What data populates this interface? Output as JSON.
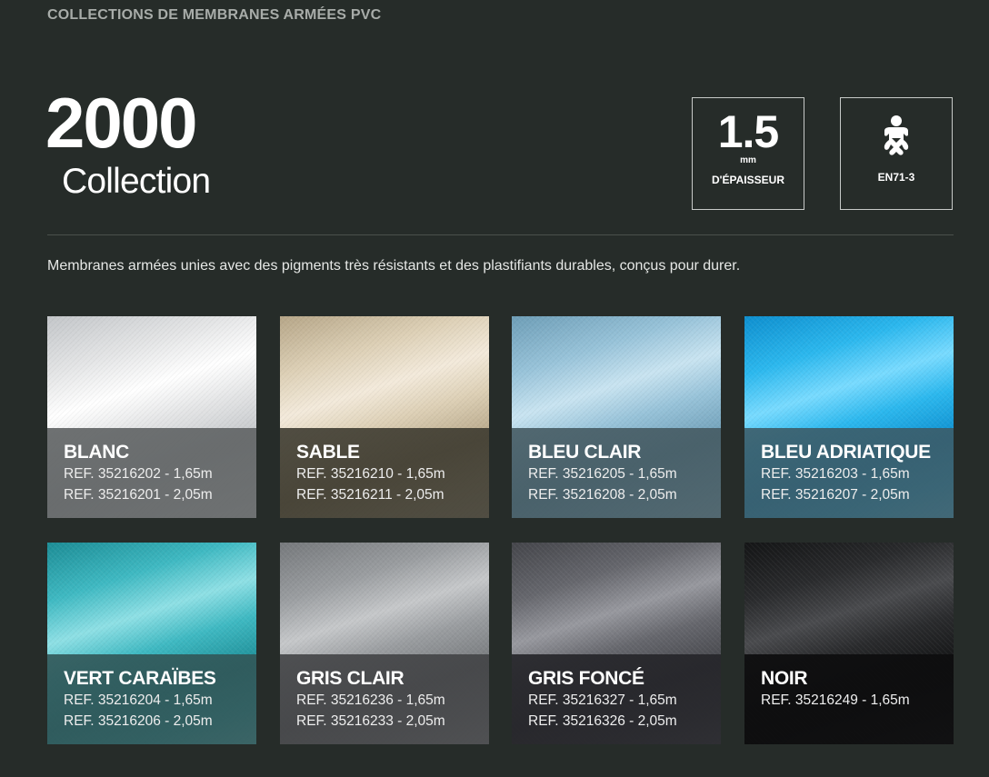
{
  "header": {
    "kicker": "COLLECTIONS DE MEMBRANES ARMÉES PVC",
    "number": "2000",
    "subtitle": "Collection"
  },
  "specs": {
    "thickness": {
      "value": "1.5",
      "unit": "mm",
      "label": "D'ÉPAISSEUR"
    },
    "norm": {
      "icon": "baby-icon",
      "label": "EN71-3"
    }
  },
  "intro": "Membranes armées unies avec des pigments très résistants et des plastifiants durables, conçus pour durer.",
  "swatches": [
    {
      "name": "BLANC",
      "refs": [
        "REF. 35216202 - 1,65m",
        "REF. 35216201 - 2,05m"
      ],
      "base": "#e4e5e6",
      "light": "#ffffff",
      "dark": "#c3c6c9",
      "caption": "rgba(98,101,102,0.92)"
    },
    {
      "name": "SABLE",
      "refs": [
        "REF. 35216210 - 1,65m",
        "REF. 35216211 - 2,05m"
      ],
      "base": "#ddd0b6",
      "light": "#f3eadb",
      "dark": "#b6a688",
      "caption": "rgba(58,56,46,0.88)"
    },
    {
      "name": "BLEU CLAIR",
      "refs": [
        "REF. 35216205 - 1,65m",
        "REF. 35216208 - 2,05m"
      ],
      "base": "#98c3d9",
      "light": "#c9e4f1",
      "dark": "#6e9eb7",
      "caption": "rgba(70,91,99,0.9)"
    },
    {
      "name": "BLEU ADRIATIQUE",
      "refs": [
        "REF. 35216203 - 1,65m",
        "REF. 35216207 - 2,05m"
      ],
      "base": "#2cb8ee",
      "light": "#79dbff",
      "dark": "#0e8fcf",
      "caption": "rgba(60,92,104,0.9)"
    },
    {
      "name": "VERT CARAÏBES",
      "refs": [
        "REF. 35216204 - 1,65m",
        "REF. 35216206 - 2,05m"
      ],
      "base": "#3fb9c2",
      "light": "#8fe0e5",
      "dark": "#1d8d96",
      "caption": "rgba(50,86,88,0.9)"
    },
    {
      "name": "GRIS CLAIR",
      "refs": [
        "REF. 35216236 - 1,65m",
        "REF. 35216233 - 2,05m"
      ],
      "base": "#9a9da0",
      "light": "#c6c8ca",
      "dark": "#76797c",
      "caption": "rgba(66,68,70,0.9)"
    },
    {
      "name": "GRIS FONCÉ",
      "refs": [
        "REF. 35216327 - 1,65m",
        "REF. 35216326 - 2,05m"
      ],
      "base": "#66676d",
      "light": "#98999f",
      "dark": "#45464b",
      "caption": "rgba(38,38,42,0.92)"
    },
    {
      "name": "NOIR",
      "refs": [
        "REF. 35216249 - 1,65m"
      ],
      "base": "#2a2b2d",
      "light": "#4a4b4e",
      "dark": "#141516",
      "caption": "rgba(14,14,15,0.94)"
    }
  ]
}
